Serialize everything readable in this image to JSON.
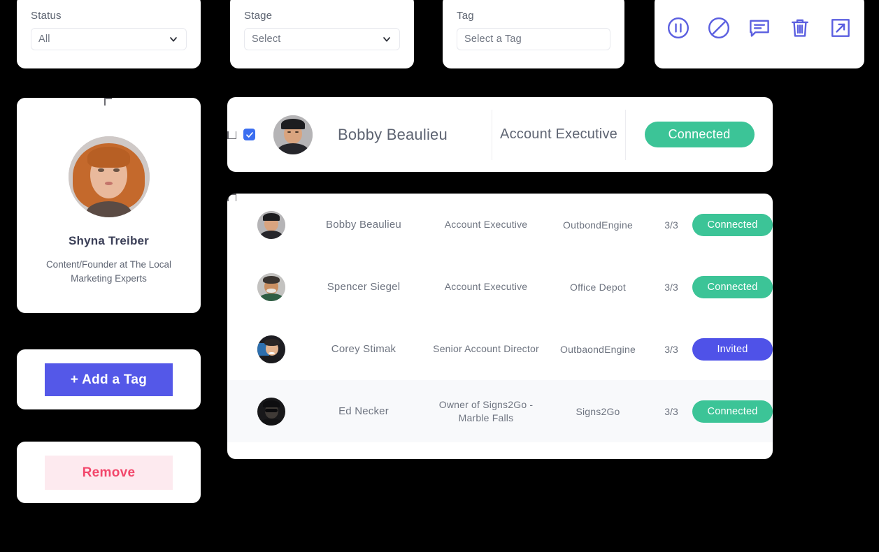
{
  "filters": {
    "status": {
      "label": "Status",
      "value": "All",
      "icon": "chevron-down-icon"
    },
    "stage": {
      "label": "Stage",
      "value": "Select",
      "icon": "chevron-down-icon"
    },
    "tag": {
      "label": "Tag",
      "value": "Select a Tag",
      "icon": "chevron-down-icon"
    }
  },
  "actions": {
    "items": [
      {
        "name": "pause-circle-icon",
        "title": "Pause"
      },
      {
        "name": "block-icon",
        "title": "Block"
      },
      {
        "name": "message-icon",
        "title": "Message"
      },
      {
        "name": "trash-icon",
        "title": "Delete"
      },
      {
        "name": "external-link-icon",
        "title": "Open"
      }
    ],
    "color": "#5b5fe0"
  },
  "profile": {
    "name": "Shyna Treiber",
    "headline": "Content/Founder at The Local Marketing Experts",
    "avatar_alt": "profile-photo"
  },
  "buttons": {
    "add_tag": {
      "label": "+ Add a Tag",
      "bg": "#5458e8",
      "fg": "#ffffff"
    },
    "remove": {
      "label": "Remove",
      "bg": "#fdeaef",
      "fg": "#f2476b"
    }
  },
  "selected_contact": {
    "checked": true,
    "name": "Bobby Beaulieu",
    "title": "Account Executive",
    "status": "Connected",
    "status_color": "#3cc497"
  },
  "table": {
    "rows": [
      {
        "name": "Bobby Beaulieu",
        "title": "Account Executive",
        "company": "OutbondEngine",
        "count": "3/3",
        "status": "Connected",
        "status_color": "#3cc497"
      },
      {
        "name": "Spencer Siegel",
        "title": "Account Executive",
        "company": "Office Depot",
        "count": "3/3",
        "status": "Connected",
        "status_color": "#3cc497"
      },
      {
        "name": "Corey Stimak",
        "title": "Senior Account Director",
        "company": "OutbaondEngine",
        "count": "3/3",
        "status": "Invited",
        "status_color": "#4f52e8"
      },
      {
        "name": "Ed Necker",
        "title": "Owner of Signs2Go - Marble Falls",
        "company": "Signs2Go",
        "count": "3/3",
        "status": "Connected",
        "status_color": "#3cc497"
      }
    ]
  },
  "theme": {
    "background": "#000000",
    "card": "#ffffff",
    "text_muted": "#6e7480",
    "accent": "#5458e8",
    "green": "#3cc497",
    "alt_row": "#f8f9fb"
  }
}
